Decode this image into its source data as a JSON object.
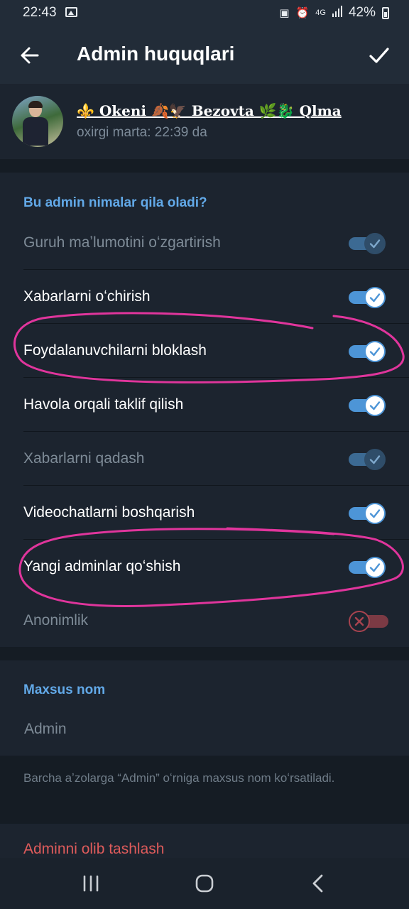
{
  "status_bar": {
    "time": "22:43",
    "network": "4G",
    "battery": "42%"
  },
  "header": {
    "title": "Admin huquqlari",
    "back_icon": "arrow-left-icon",
    "done_icon": "check-icon"
  },
  "user": {
    "name": "⚜️️ Okeni 🍂🦅 Bezovta 🌿🐉 Qlma️",
    "status": "oxirgi marta: 22:39 da"
  },
  "permissions": {
    "title": "Bu admin nimalar qila oladi?",
    "items": [
      {
        "label": "Guruh maʼlumotini oʻzgartirish",
        "enabled": true,
        "disabled": true
      },
      {
        "label": "Xabarlarni oʻchirish",
        "enabled": true,
        "disabled": false
      },
      {
        "label": "Foydalanuvchilarni bloklash",
        "enabled": true,
        "disabled": false
      },
      {
        "label": "Havola orqali taklif qilish",
        "enabled": true,
        "disabled": false
      },
      {
        "label": "Xabarlarni qadash",
        "enabled": true,
        "disabled": true
      },
      {
        "label": "Videochatlarni boshqarish",
        "enabled": true,
        "disabled": false
      },
      {
        "label": "Yangi adminlar qoʻshish",
        "enabled": true,
        "disabled": false
      },
      {
        "label": "Anonimlik",
        "enabled": false,
        "disabled": true
      }
    ]
  },
  "custom_title": {
    "title": "Maxsus nom",
    "placeholder": "Admin",
    "hint": "Barcha aʼzolarga “Admin” oʻrniga maxsus nom koʻrsatiladi."
  },
  "dismiss_label": "Adminni olib tashlash",
  "colors": {
    "accent": "#62a9e8",
    "toggle_on": "#4d95d7",
    "danger": "#de5b5b",
    "annotation": "#e0359c"
  }
}
